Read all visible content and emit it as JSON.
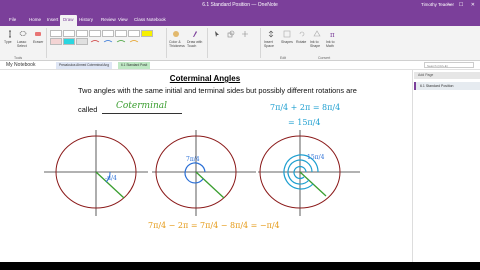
{
  "window": {
    "title": "6.1 Standard Position — OneNote",
    "user": "Timothy Teacher",
    "controls": "— ☐ ✕"
  },
  "tabs": [
    {
      "label": "File"
    },
    {
      "label": "Home"
    },
    {
      "label": "Insert"
    },
    {
      "label": "Draw"
    },
    {
      "label": "History"
    },
    {
      "label": "Review"
    },
    {
      "label": "View"
    },
    {
      "label": "Class Notebook"
    }
  ],
  "ribbon": {
    "tools": {
      "type": "Type",
      "lasso": "Lasso Select",
      "eraser": "Eraser",
      "group": "Tools"
    },
    "buttons": [
      "Color & Thickness",
      "Draw with Touch",
      "Insert Space",
      "Shapes",
      "Rotate",
      "Ink to Shape",
      "Ink to Math"
    ],
    "groups": [
      "Tools",
      "Edit",
      "Convert"
    ],
    "colors": {
      "pen1": "#222222",
      "highlighter_yellow": "#f6f000",
      "highlighter_cyan": "#2bd6e0",
      "accent": "#7b3f9a"
    }
  },
  "notebook": {
    "name": "My Notebook",
    "sections": [
      "Precalculus Ahmed Coterminal Ang",
      "6.1 Standard Posit"
    ],
    "search_placeholder": "Search (Ctrl+E)"
  },
  "page_panel": {
    "add_page": "Add Page",
    "pages": [
      "6.1 Standard Position"
    ]
  },
  "page": {
    "heading": "Coterminal Angles",
    "description": "Two angles with the same initial and terminal sides but possibly different rotations are",
    "called": "called",
    "answer": "Coterminal"
  },
  "math": {
    "angle1": "-π/4",
    "angle2": "7π/4",
    "angle3": "15π/4",
    "top_eq_a": "7π/4 + 2π = 8π/4",
    "top_eq_b": "= 15π/4",
    "bottom_eq": "7π/4 − 2π = 7π/4 − 8π/4 = −π/4"
  }
}
